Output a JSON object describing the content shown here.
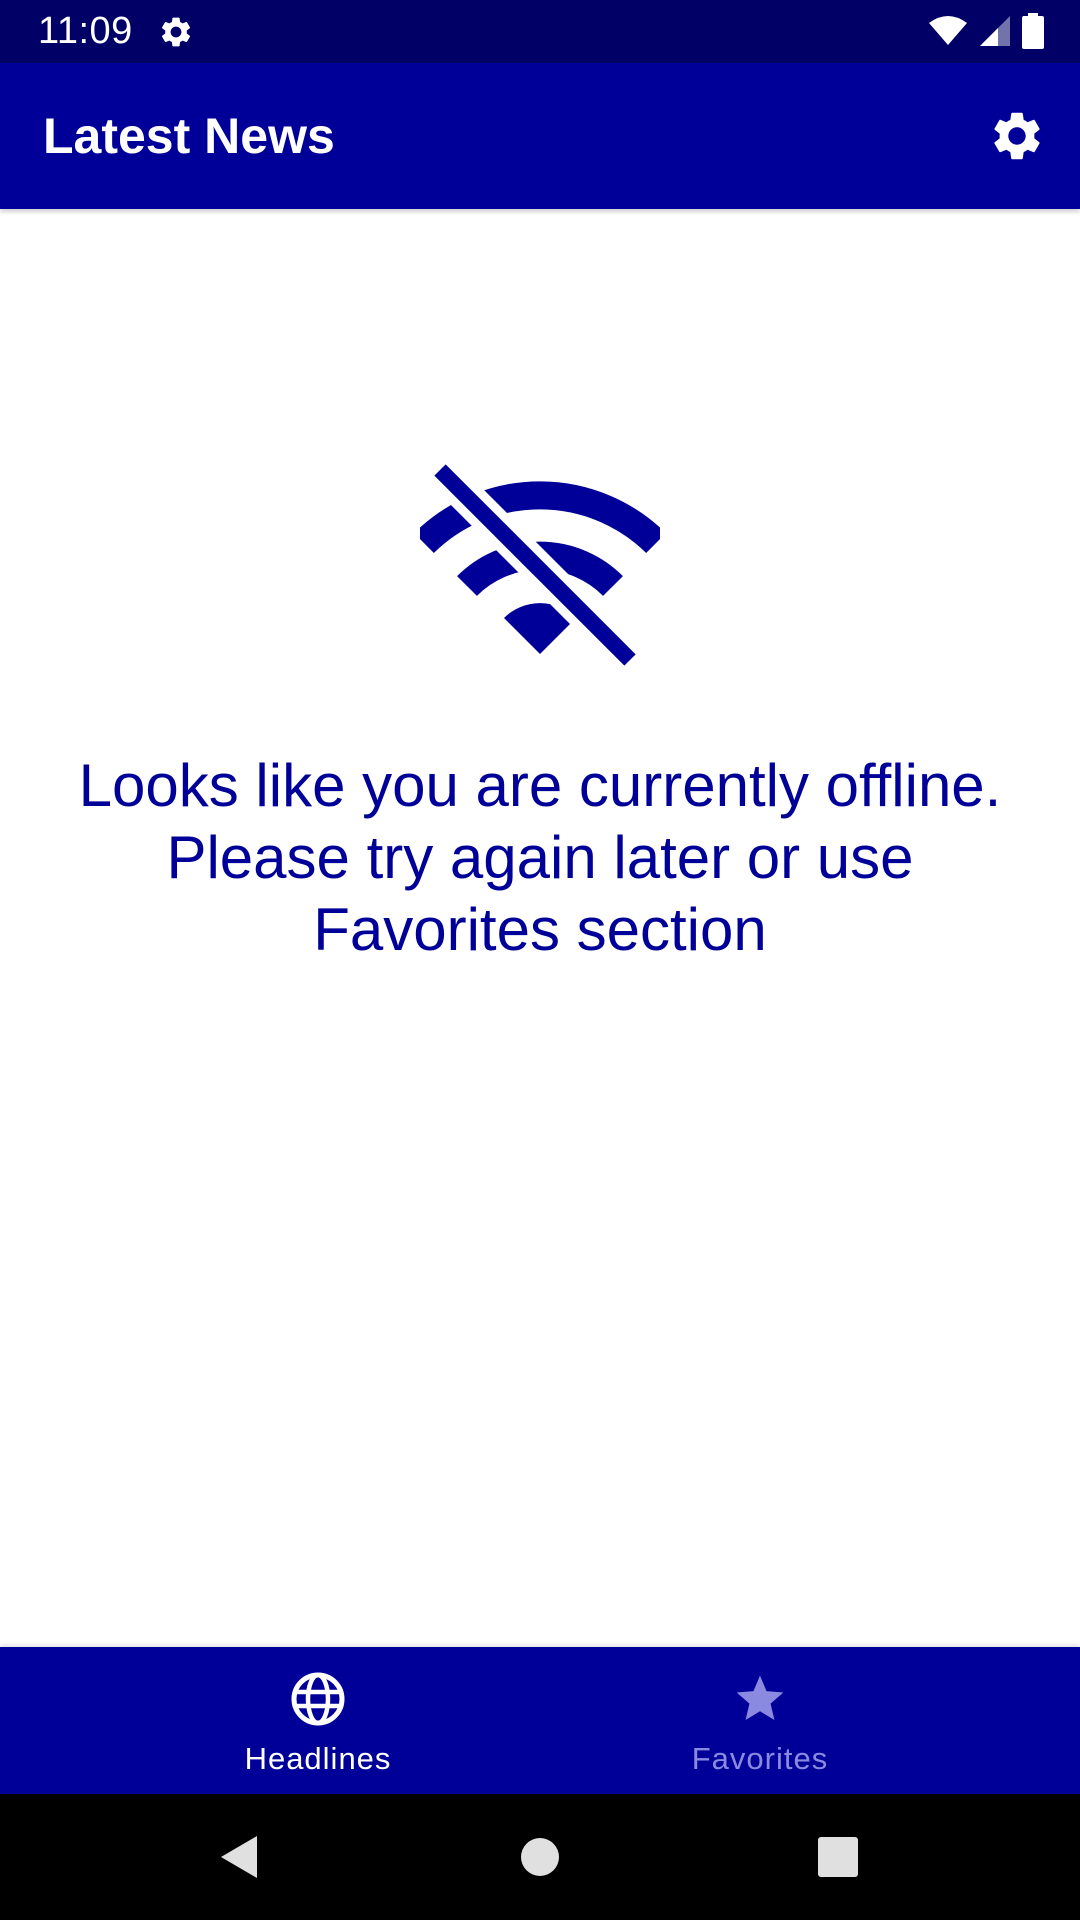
{
  "status_bar": {
    "time": "11:09",
    "icons": [
      "gear-icon",
      "wifi-icon",
      "signal-icon",
      "battery-icon"
    ]
  },
  "app_bar": {
    "title": "Latest News",
    "action_icon": "gear-icon"
  },
  "offline": {
    "icon": "wifi-off-icon",
    "message": "Looks like you are currently offline. Please try again later or use Favorites section"
  },
  "bottom_nav": {
    "items": [
      {
        "label": "Headlines",
        "icon": "globe-icon",
        "selected": true
      },
      {
        "label": "Favorites",
        "icon": "star-icon",
        "selected": false
      }
    ]
  },
  "system_nav": {
    "buttons": [
      "back-icon",
      "home-icon",
      "recents-icon"
    ]
  },
  "colors": {
    "status_bar": "#000066",
    "primary": "#000099",
    "inactive": "#8a8ae0",
    "on_primary": "#ffffff",
    "background": "#ffffff"
  }
}
